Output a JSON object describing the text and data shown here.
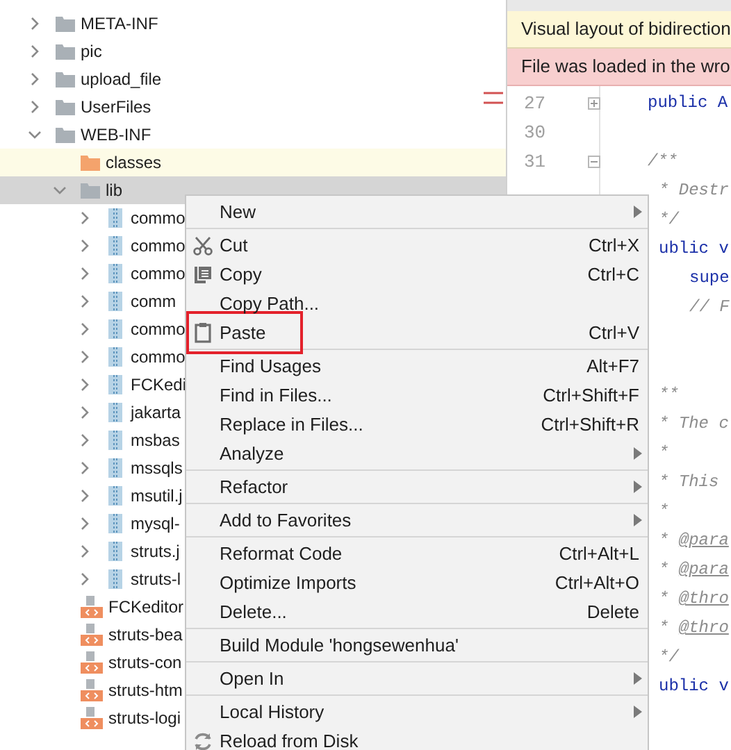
{
  "tree": [
    {
      "label": "META-INF",
      "kind": "folder",
      "expanded": false,
      "selected": false
    },
    {
      "label": "pic",
      "kind": "folder",
      "expanded": false,
      "selected": false
    },
    {
      "label": "upload_file",
      "kind": "folder",
      "expanded": false,
      "selected": false
    },
    {
      "label": "UserFiles",
      "kind": "folder",
      "expanded": false,
      "selected": false
    },
    {
      "label": "WEB-INF",
      "kind": "folder",
      "expanded": true,
      "selected": false,
      "children": [
        {
          "label": "classes",
          "kind": "output-folder",
          "selected": false
        },
        {
          "label": "lib",
          "kind": "folder",
          "expanded": true,
          "selected": true,
          "children": [
            {
              "label": "commo",
              "kind": "jar",
              "expanded": false,
              "selected": false
            },
            {
              "label": "commo",
              "kind": "jar",
              "expanded": false,
              "selected": false
            },
            {
              "label": "commo",
              "kind": "jar",
              "expanded": false,
              "selected": false
            },
            {
              "label": "comm",
              "kind": "jar",
              "expanded": false,
              "selected": false
            },
            {
              "label": "commo",
              "kind": "jar",
              "expanded": false,
              "selected": false
            },
            {
              "label": "commo",
              "kind": "jar",
              "expanded": false,
              "selected": false
            },
            {
              "label": "FCKedi",
              "kind": "jar",
              "expanded": false,
              "selected": false
            },
            {
              "label": "jakarta",
              "kind": "jar",
              "expanded": false,
              "selected": false
            },
            {
              "label": "msbas",
              "kind": "jar",
              "expanded": false,
              "selected": false
            },
            {
              "label": "mssqls",
              "kind": "jar",
              "expanded": false,
              "selected": false
            },
            {
              "label": "msutil.j",
              "kind": "jar",
              "expanded": false,
              "selected": false
            },
            {
              "label": "mysql-",
              "kind": "jar",
              "expanded": false,
              "selected": false
            },
            {
              "label": "struts.j",
              "kind": "jar",
              "expanded": false,
              "selected": false
            },
            {
              "label": "struts-l",
              "kind": "jar",
              "expanded": false,
              "selected": false
            }
          ]
        },
        {
          "label": "FCKeditor",
          "kind": "xml",
          "selected": false
        },
        {
          "label": "struts-bea",
          "kind": "xml",
          "selected": false
        },
        {
          "label": "struts-con",
          "kind": "xml",
          "selected": false
        },
        {
          "label": "struts-htm",
          "kind": "xml",
          "selected": false
        },
        {
          "label": "struts-logi",
          "kind": "xml",
          "selected": false
        }
      ]
    }
  ],
  "editor": {
    "banners": [
      {
        "kind": "warning",
        "text": "Visual layout of bidirection"
      },
      {
        "kind": "error",
        "text": "File was loaded in the wro"
      }
    ],
    "lines": [
      {
        "number": "27",
        "collapsed": true,
        "kind": "code-top",
        "text": "public A"
      },
      {
        "number": "30",
        "kind": "blank"
      },
      {
        "number": "31",
        "collapsed": false,
        "kind": "comment-top",
        "text": "/**"
      },
      {
        "kind": "comment",
        "text": "* Destr"
      },
      {
        "kind": "comment",
        "text": "*/"
      },
      {
        "kind": "code",
        "text": "ublic v"
      },
      {
        "kind": "code-nested",
        "text": "supe"
      },
      {
        "kind": "comment-nested",
        "text": "// F"
      },
      {
        "kind": "blank"
      },
      {
        "kind": "blank"
      },
      {
        "kind": "comment",
        "text": "**"
      },
      {
        "kind": "comment",
        "text": "* The c"
      },
      {
        "kind": "comment",
        "text": "*"
      },
      {
        "kind": "comment",
        "text": "* This"
      },
      {
        "kind": "comment",
        "text": "*"
      },
      {
        "kind": "doc-tag",
        "marker": "*",
        "text": "@para"
      },
      {
        "kind": "doc-tag",
        "marker": "*",
        "text": "@para"
      },
      {
        "kind": "doc-tag",
        "marker": "*",
        "text": "@thro"
      },
      {
        "kind": "doc-tag",
        "marker": "*",
        "text": "@thro"
      },
      {
        "kind": "comment",
        "text": "*/"
      },
      {
        "kind": "code",
        "text": "ublic v"
      }
    ]
  },
  "context_menu": {
    "groups": [
      [
        {
          "label": "New",
          "submenu": true,
          "highlighted": false
        }
      ],
      [
        {
          "label": "Cut",
          "kind": "cut",
          "shortcut": "Ctrl+X",
          "highlighted": false
        },
        {
          "label": "Copy",
          "kind": "copy",
          "shortcut": "Ctrl+C",
          "highlighted": false
        },
        {
          "label": "Copy Path...",
          "highlighted": false
        },
        {
          "label": "Paste",
          "kind": "paste",
          "shortcut": "Ctrl+V",
          "highlighted": true
        }
      ],
      [
        {
          "label": "Find Usages",
          "shortcut": "Alt+F7",
          "highlighted": false
        },
        {
          "label": "Find in Files...",
          "shortcut": "Ctrl+Shift+F",
          "highlighted": false
        },
        {
          "label": "Replace in Files...",
          "shortcut": "Ctrl+Shift+R",
          "highlighted": false
        },
        {
          "label": "Analyze",
          "submenu": true,
          "highlighted": false
        }
      ],
      [
        {
          "label": "Refactor",
          "submenu": true,
          "highlighted": false
        }
      ],
      [
        {
          "label": "Add to Favorites",
          "submenu": true,
          "highlighted": false
        }
      ],
      [
        {
          "label": "Reformat Code",
          "shortcut": "Ctrl+Alt+L",
          "highlighted": false
        },
        {
          "label": "Optimize Imports",
          "shortcut": "Ctrl+Alt+O",
          "highlighted": false
        },
        {
          "label": "Delete...",
          "shortcut": "Delete",
          "highlighted": false
        }
      ],
      [
        {
          "label": "Build Module 'hongsewenhua'",
          "highlighted": false
        }
      ],
      [
        {
          "label": "Open In",
          "submenu": true,
          "highlighted": false
        }
      ],
      [
        {
          "label": "Local History",
          "submenu": true,
          "highlighted": false
        },
        {
          "label": "Reload from Disk",
          "kind": "reload",
          "highlighted": false
        }
      ]
    ]
  }
}
